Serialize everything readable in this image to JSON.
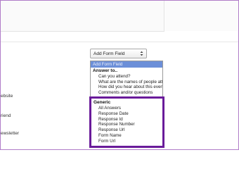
{
  "form": {
    "left_labels": [
      "ebsite",
      "riend",
      "ewsletter"
    ]
  },
  "add_field": {
    "label": "Add Form Field",
    "dropdown": {
      "placeholder": "Add Form Field",
      "answer_group": {
        "title": "Answer to..",
        "items": [
          "Can you attend?",
          "What are the names of people attending?",
          "How did you hear about this event?",
          "Comments and/or questions"
        ]
      }
    },
    "generic_group": {
      "title": "Generic",
      "items": [
        "All Answers",
        "Response Date",
        "Response Id",
        "Response Number",
        "Response Url",
        "Form Name",
        "Form Url"
      ]
    }
  },
  "colors": {
    "highlight_border": "#6a1b9a",
    "placeholder_bg": "#6c8fd8",
    "frame_border": "#b07cc8"
  }
}
